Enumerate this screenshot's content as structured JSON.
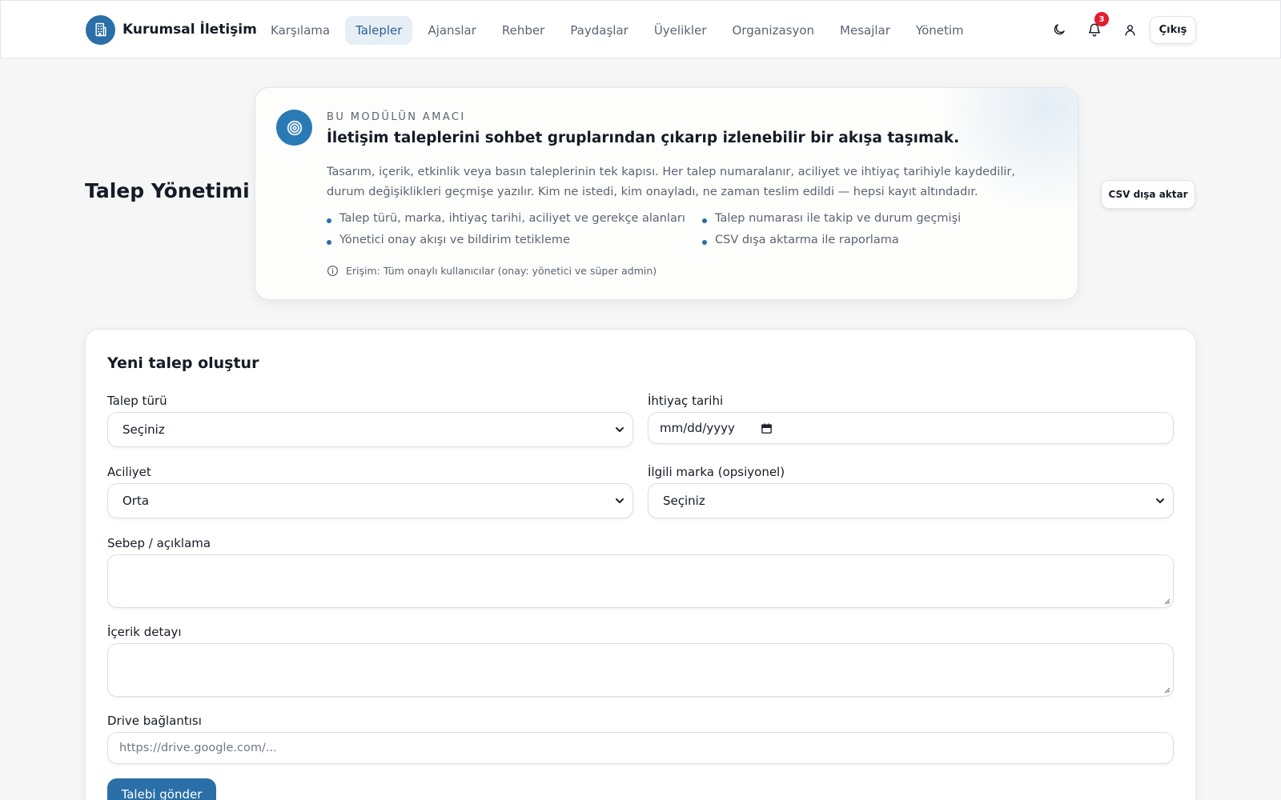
{
  "brand": {
    "name": "Kurumsal İletişim",
    "logo_icon": "building-icon",
    "accent": "#2a6fa7"
  },
  "nav": {
    "items": [
      {
        "label": "Karşılama",
        "active": false
      },
      {
        "label": "Talepler",
        "active": true
      },
      {
        "label": "Ajanslar",
        "active": false
      },
      {
        "label": "Rehber",
        "active": false
      },
      {
        "label": "Paydaşlar",
        "active": false
      },
      {
        "label": "Üyelikler",
        "active": false
      },
      {
        "label": "Organizasyon",
        "active": false
      },
      {
        "label": "Mesajlar",
        "active": false
      },
      {
        "label": "Yönetim",
        "active": false
      }
    ]
  },
  "toolbar": {
    "theme_icon": "moon-icon",
    "notifications_icon": "bell-icon",
    "notification_count": "3",
    "badge_color": "#e11d2e",
    "user_icon": "user-icon",
    "logout_label": "Çıkış"
  },
  "page": {
    "title": "Talep Yönetimi",
    "export_label": "CSV dışa aktar"
  },
  "purpose": {
    "icon": "target-icon",
    "kicker": "BU MODÜLÜN AMACI",
    "headline": "İletişim taleplerini sohbet gruplarından çıkarıp izlenebilir bir akışa taşımak.",
    "description": "Tasarım, içerik, etkinlik veya basın taleplerinin tek kapısı. Her talep numaralanır, aciliyet ve ihtiyaç tarihiyle kaydedilir, durum değişiklikleri geçmişe yazılır. Kim ne istedi, kim onayladı, ne zaman teslim edildi — hepsi kayıt altındadır.",
    "features": [
      "Talep türü, marka, ihtiyaç tarihi, aciliyet ve gerekçe alanları",
      "Talep numarası ile takip ve durum geçmişi",
      "Yönetici onay akışı ve bildirim tetikleme",
      "CSV dışa aktarma ile raporlama"
    ],
    "access_icon": "info-icon",
    "access": "Erişim: Tüm onaylı kullanıcılar (onay: yönetici ve süper admin)"
  },
  "form": {
    "title": "Yeni talep oluştur",
    "request_type": {
      "label": "Talep türü",
      "value": "Seçiniz"
    },
    "need_date": {
      "label": "İhtiyaç tarihi",
      "value": "mm/dd/yyyy"
    },
    "urgency": {
      "label": "Aciliyet",
      "value": "Orta"
    },
    "brand": {
      "label": "İlgili marka (opsiyonel)",
      "value": "Seçiniz"
    },
    "reason": {
      "label": "Sebep / açıklama",
      "value": ""
    },
    "content": {
      "label": "İçerik detayı",
      "value": ""
    },
    "drive": {
      "label": "Drive bağlantısı",
      "value": "",
      "placeholder": "https://drive.google.com/..."
    },
    "submit_label": "Talebi gönder"
  }
}
